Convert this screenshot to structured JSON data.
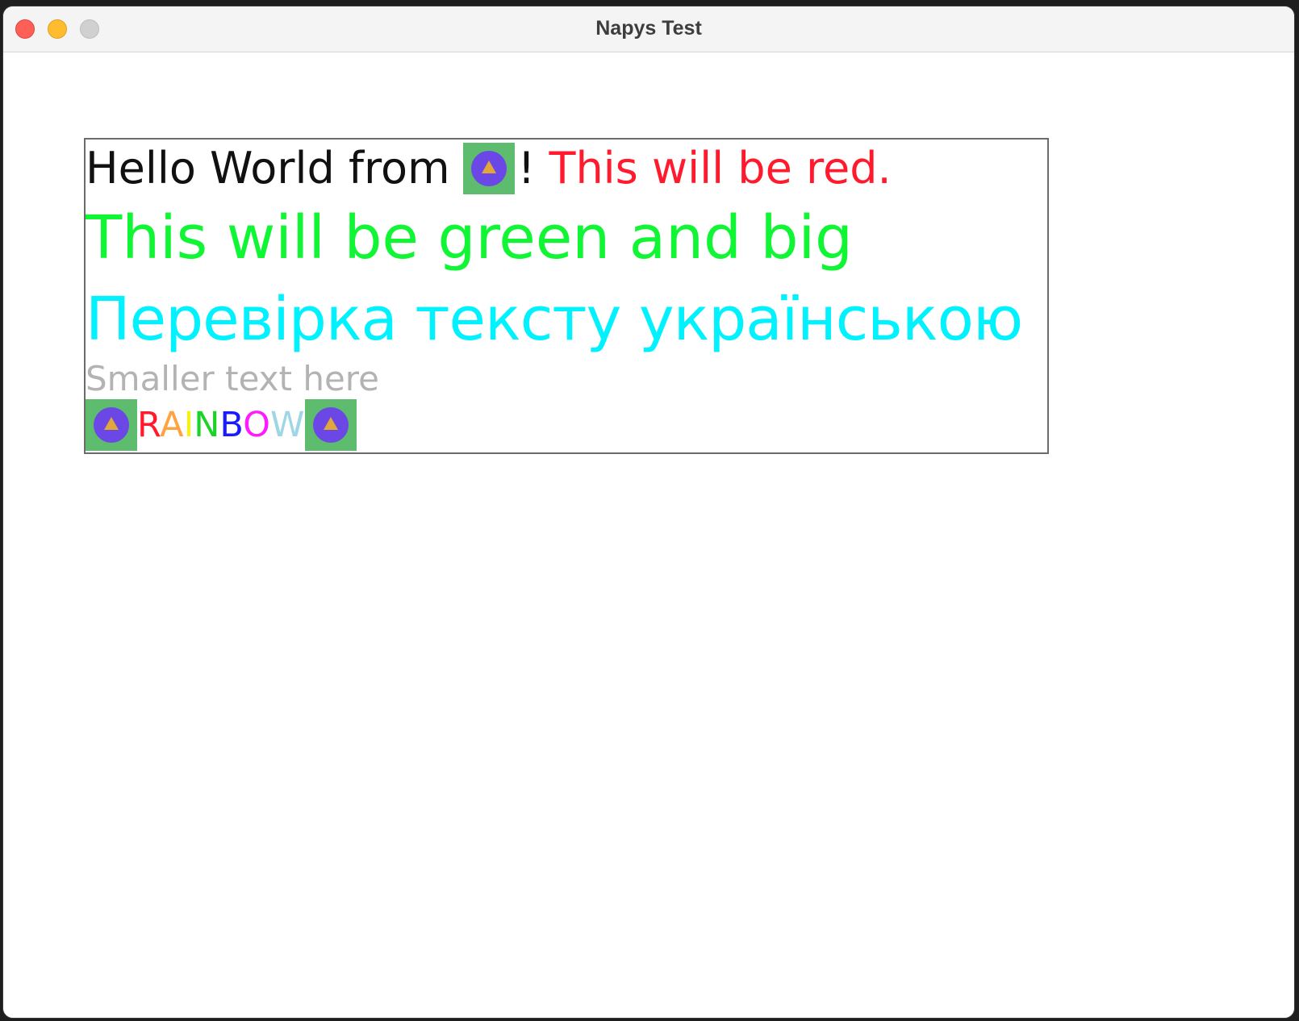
{
  "window": {
    "title": "Napys Test"
  },
  "traffic_lights": {
    "close": "close-button",
    "minimize": "minimize-button",
    "zoom": "zoom-button"
  },
  "colors": {
    "black": "#111111",
    "red": "#ff1a2e",
    "green": "#10f534",
    "cyan": "#00f2ff",
    "gray": "#b3b3b3",
    "image_bg": "#5dbc6d",
    "badge": "#6b47e6",
    "triangle": "#e2a73b"
  },
  "lines": {
    "hello_prefix": "Hello World from",
    "hello_bang": "!",
    "red_text": "This will be red.",
    "green_text": "This will be green and big",
    "ukrainian_text": "Перевірка тексту українською",
    "smaller_text": "Smaller text here"
  },
  "rainbow": {
    "letters": [
      {
        "char": "R",
        "color": "#ff1a2e"
      },
      {
        "char": "A",
        "color": "#ffa340"
      },
      {
        "char": "I",
        "color": "#f5f11a"
      },
      {
        "char": "N",
        "color": "#1ad326"
      },
      {
        "char": "B",
        "color": "#1a1aff"
      },
      {
        "char": "O",
        "color": "#ff1aff"
      },
      {
        "char": "W",
        "color": "#9fd6e6"
      }
    ]
  },
  "icons": {
    "inline_image": "image-icon"
  }
}
